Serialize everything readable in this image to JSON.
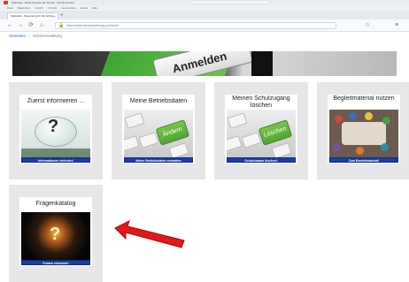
{
  "browser": {
    "window_title": "Startseite - Bewertung für die Schule - Mozilla Firefox",
    "menu_items": [
      "Datei",
      "Bearbeiten",
      "Ansicht",
      "Chronik",
      "Lesezeichen",
      "Extras",
      "Hilfe"
    ],
    "tab_title": "Startseite - Bewertung für die Schule",
    "tab_close": "×",
    "new_tab": "+",
    "nav": {
      "back": "←",
      "forward": "→",
      "reload": "⟳",
      "home": "⌂"
    },
    "url": "https://www.schulbewertung-portal.de/",
    "lock": "🔒",
    "bookmark": "☆",
    "menu": "≡"
  },
  "breadcrumb": {
    "home": "Startseite",
    "separator": "/",
    "current": "Schulverwaltung"
  },
  "hero": {
    "key_text": "Anmelden"
  },
  "cards": [
    {
      "title": "Zuerst informieren ...",
      "button": "Informationen einholen!",
      "image": "piggy-bank-question"
    },
    {
      "title": "Meine Betriebsdaten",
      "key_text": "Ändern",
      "button": "Meine Betriebsdaten verwalten",
      "image": "keyboard-key-aendern"
    },
    {
      "title": "Meinen Schulzugang löschen",
      "key_text": "Löschen",
      "button": "Schulzugang löschen!",
      "image": "keyboard-key-loeschen"
    },
    {
      "title": "Begleitmaterial nutzen",
      "button": "Zum Begleitmaterial!",
      "image": "meeting-table"
    },
    {
      "title": "Fragenkatalog",
      "button": "Fragen eingeben!",
      "image": "glowing-bulb-question"
    }
  ],
  "piggy_q": "?",
  "bulb_q": "?",
  "colors": {
    "button_bg": "#1a3fa0",
    "card_bg": "#e7e7e7",
    "arrow": "#e01818"
  }
}
